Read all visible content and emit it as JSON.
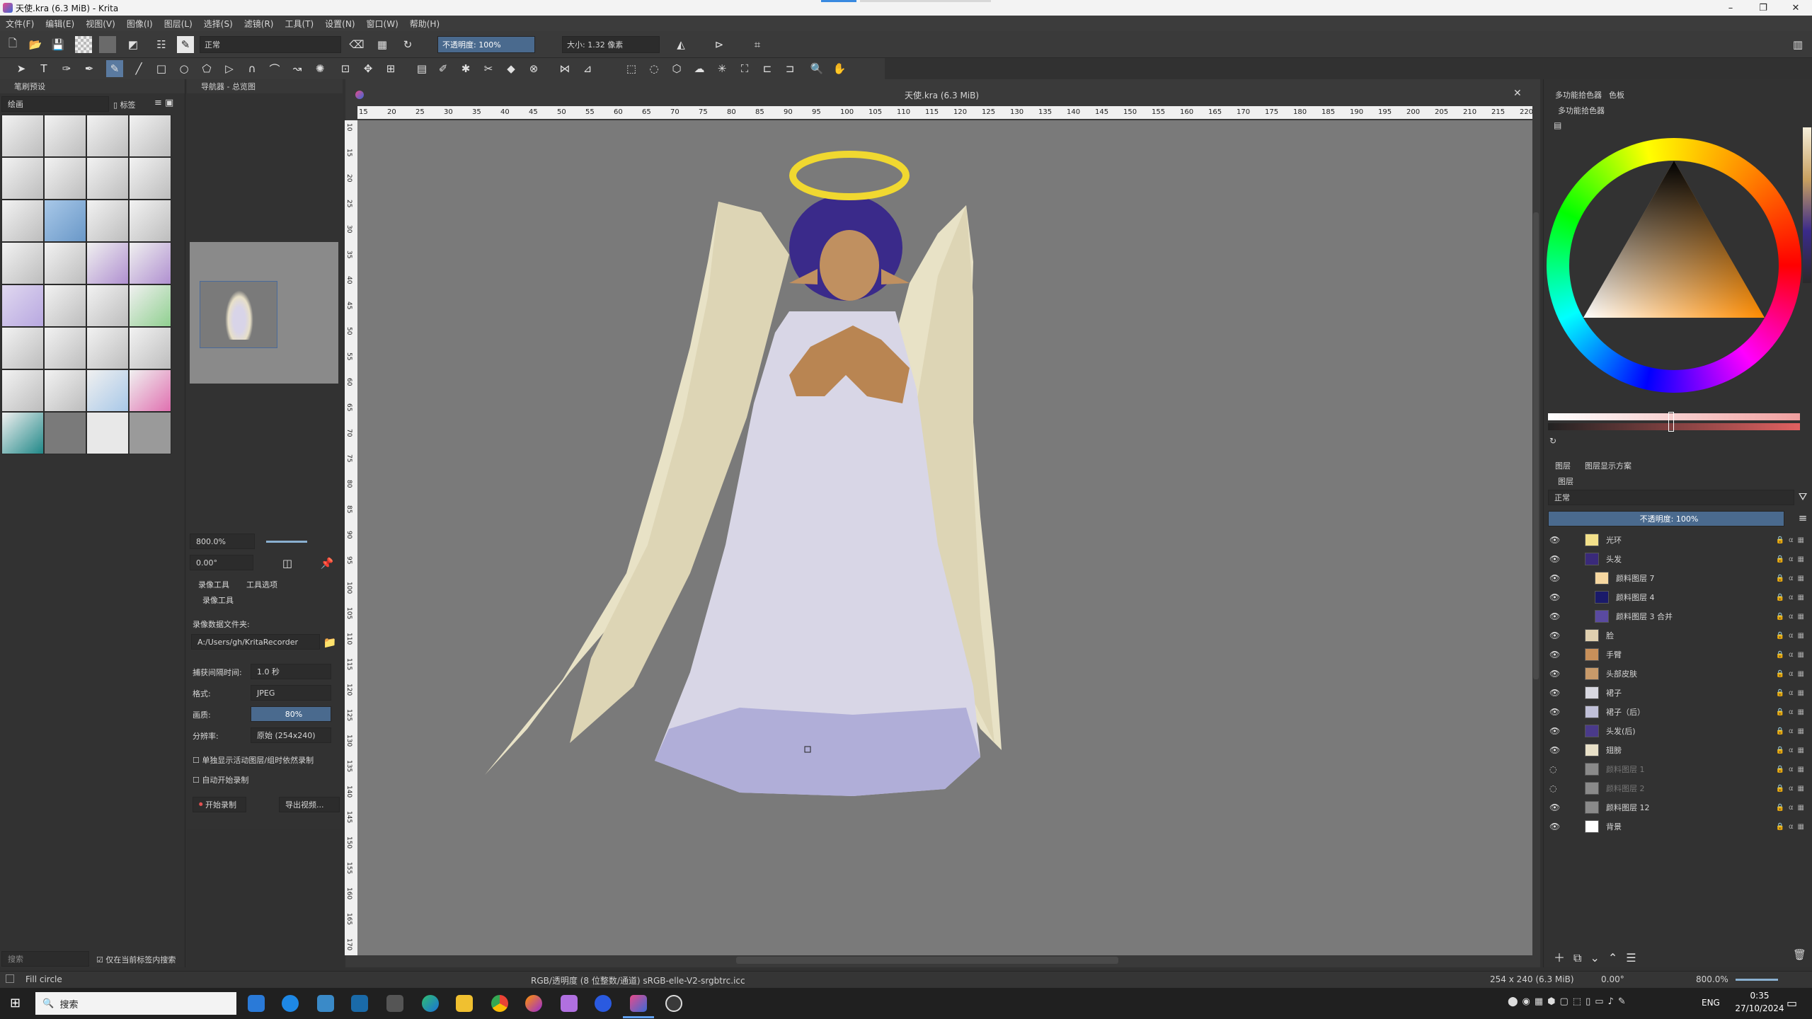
{
  "window": {
    "title": "天使.kra (6.3 MiB) - Krita",
    "minimize": "–",
    "maximize": "❐",
    "close": "✕"
  },
  "menu": [
    "文件(F)",
    "编辑(E)",
    "视图(V)",
    "图像(I)",
    "图层(L)",
    "选择(S)",
    "滤镜(R)",
    "工具(T)",
    "设置(N)",
    "窗口(W)",
    "帮助(H)"
  ],
  "toolbar": {
    "blend_mode": "正常",
    "opacity_label": "不透明度: 100%",
    "size_label": "大小: 1.32 像素"
  },
  "brush_presets": {
    "title": "笔刷预设",
    "filter": "绘画",
    "tag": "标签",
    "search": "搜索",
    "search_in_tag": "仅在当前标签内搜索"
  },
  "navigator": {
    "title": "导航器 - 总览图",
    "zoom": "800.0%",
    "rotation": "0.00°"
  },
  "recorder": {
    "tabs": [
      "录像工具",
      "工具选项"
    ],
    "title": "录像工具",
    "folder_label": "录像数据文件夹:",
    "folder_value": "A:/Users/gh/KritaRecorder",
    "interval_label": "捕获间隔时间:",
    "interval_value": "1.0 秒",
    "format_label": "格式:",
    "format_value": "JPEG",
    "quality_label": "画质:",
    "quality_value": "80%",
    "resolution_label": "分辨率:",
    "resolution_value": "原始 (254x240)",
    "opt1": "单独显示活动图层/组时依然录制",
    "opt2": "自动开始录制",
    "record_btn": "开始录制",
    "export_btn": "导出视频..."
  },
  "document": {
    "tab_title": "天使.kra (6.3 MiB)"
  },
  "ruler_h": [
    "15",
    "20",
    "25",
    "30",
    "35",
    "40",
    "45",
    "50",
    "55",
    "60",
    "65",
    "70",
    "75",
    "80",
    "85",
    "90",
    "95",
    "100",
    "105",
    "110",
    "115",
    "120",
    "125",
    "130",
    "135",
    "140",
    "145",
    "150",
    "155",
    "160",
    "165",
    "170",
    "175",
    "180",
    "185",
    "190",
    "195",
    "200",
    "205",
    "210",
    "215",
    "220"
  ],
  "ruler_v": [
    "10",
    "15",
    "20",
    "25",
    "30",
    "35",
    "40",
    "45",
    "50",
    "55",
    "60",
    "65",
    "70",
    "75",
    "80",
    "85",
    "90",
    "95",
    "100",
    "105",
    "110",
    "115",
    "120",
    "125",
    "130",
    "135",
    "140",
    "145",
    "150",
    "155",
    "160",
    "165",
    "170"
  ],
  "color_panel": {
    "tabs": [
      "多功能拾色器",
      "色板"
    ],
    "title": "多功能拾色器"
  },
  "layers_panel": {
    "tabs": [
      "图层",
      "图层显示方案"
    ],
    "title": "图层",
    "blend_mode": "正常",
    "opacity": "不透明度: 100%",
    "layers": [
      {
        "name": "光环",
        "visible": true,
        "thumb": "#f2e08a",
        "indent": 0
      },
      {
        "name": "头发",
        "visible": true,
        "thumb": "#3a2a7a",
        "indent": 0
      },
      {
        "name": "颜料图层 7",
        "visible": true,
        "thumb": "#f6d7a0",
        "indent": 1
      },
      {
        "name": "颜料图层 4",
        "visible": true,
        "thumb": "#1a1a6a",
        "indent": 1
      },
      {
        "name": "颜料图层 3 合并",
        "visible": true,
        "thumb": "#5a4aa0",
        "indent": 1
      },
      {
        "name": "脸",
        "visible": true,
        "thumb": "#e0d0b0",
        "indent": 0
      },
      {
        "name": "手臂",
        "visible": true,
        "thumb": "#c8905a",
        "indent": 0
      },
      {
        "name": "头部皮肤",
        "visible": true,
        "thumb": "#c89a6a",
        "indent": 0
      },
      {
        "name": "裙子",
        "visible": true,
        "thumb": "#d8d8e0",
        "indent": 0
      },
      {
        "name": "裙子（后）",
        "visible": true,
        "thumb": "#c0c0d8",
        "indent": 0
      },
      {
        "name": "头发(后)",
        "visible": true,
        "thumb": "#4a3a8a",
        "indent": 0
      },
      {
        "name": "翅膀",
        "visible": true,
        "thumb": "#e8e0c8",
        "indent": 0
      },
      {
        "name": "颜料图层 1",
        "visible": false,
        "thumb": "#8a8a8a",
        "indent": 0
      },
      {
        "name": "颜料图层 2",
        "visible": false,
        "thumb": "#8a8a8a",
        "indent": 0
      },
      {
        "name": "颜料图层 12",
        "visible": true,
        "thumb": "#8a8a8a",
        "indent": 0
      },
      {
        "name": "背景",
        "visible": true,
        "thumb": "#ffffff",
        "indent": 0
      }
    ]
  },
  "status": {
    "tool": "Fill circle",
    "color_info": "RGB/透明度 (8 位整数/通道)  sRGB-elle-V2-srgbtrc.icc",
    "size_info": "254 x 240 (6.3 MiB)",
    "rotation": "0.00°",
    "zoom": "800.0%"
  },
  "taskbar": {
    "search": "搜索",
    "lang": "ENG",
    "time": "0:35",
    "date": "27/10/2024"
  }
}
